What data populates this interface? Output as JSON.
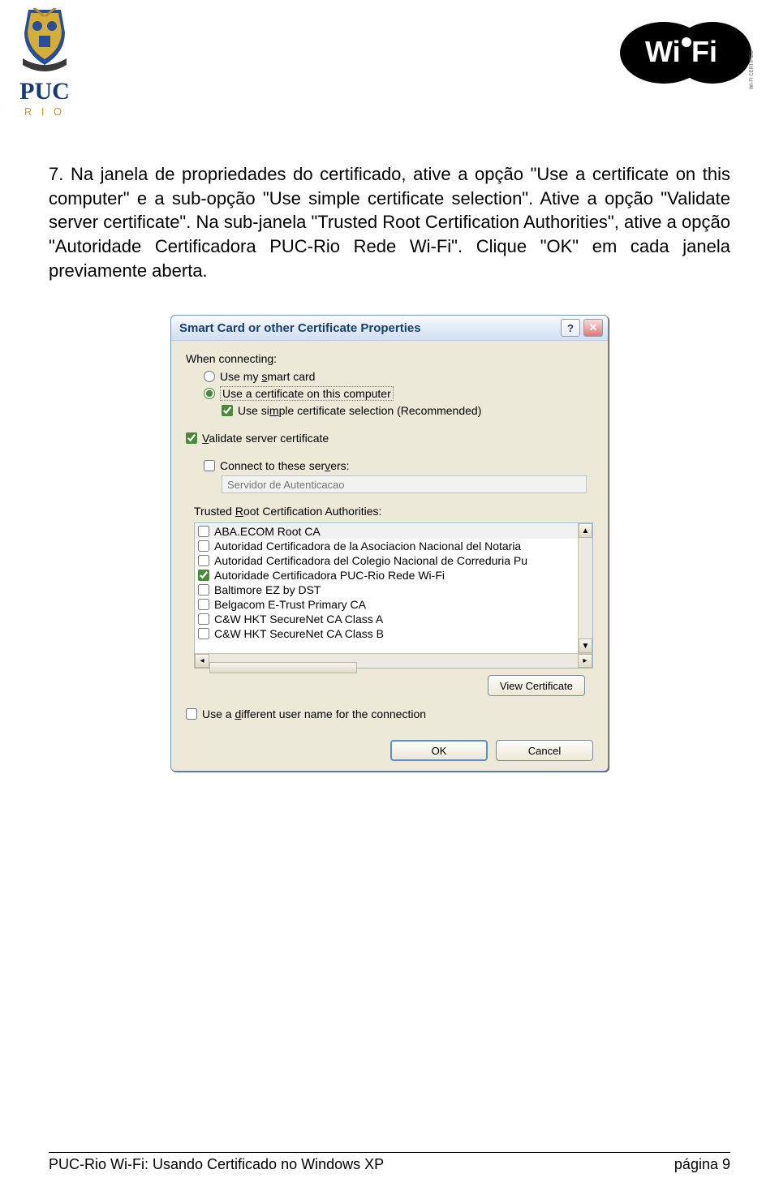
{
  "logos": {
    "puc_text_top": "PUC",
    "puc_text_bottom": "R I O"
  },
  "paragraph": "7. Na janela de propriedades do certificado, ative a opção \"Use a certificate on this computer\" e a sub-opção \"Use simple certificate selection\". Ative a opção \"Validate server certificate\". Na sub-janela \"Trusted Root Certification Authorities\", ative a opção \"Autoridade Certificadora PUC-Rio Rede Wi-Fi\". Clique \"OK\" em cada janela previamente aberta.",
  "dialog": {
    "title": "Smart Card or other Certificate Properties",
    "when_connecting": "When connecting:",
    "use_smart_card": "Use my smart card",
    "use_cert_computer": "Use a certificate on this computer",
    "use_simple_sel": "Use simple certificate selection (Recommended)",
    "validate_server": "Validate server certificate",
    "connect_servers": "Connect to these servers:",
    "server_placeholder": "Servidor de Autenticacao",
    "trusted_root": "Trusted Root Certification Authorities:",
    "cas": [
      {
        "label": "ABA.ECOM Root CA",
        "checked": false,
        "sel": true
      },
      {
        "label": "Autoridad Certificadora de la Asociacion Nacional del Notaria",
        "checked": false
      },
      {
        "label": "Autoridad Certificadora del Colegio Nacional de Correduria Pu",
        "checked": false
      },
      {
        "label": "Autoridade Certificadora PUC-Rio Rede Wi-Fi",
        "checked": true
      },
      {
        "label": "Baltimore EZ by DST",
        "checked": false
      },
      {
        "label": "Belgacom E-Trust Primary CA",
        "checked": false
      },
      {
        "label": "C&W HKT SecureNet CA Class A",
        "checked": false
      },
      {
        "label": "C&W HKT SecureNet CA Class B",
        "checked": false
      }
    ],
    "view_cert": "View Certificate",
    "diff_user": "Use a different user name for the connection",
    "ok": "OK",
    "cancel": "Cancel"
  },
  "footer": {
    "left": "PUC-Rio Wi-Fi: Usando Certificado no Windows XP",
    "right": "página 9"
  }
}
